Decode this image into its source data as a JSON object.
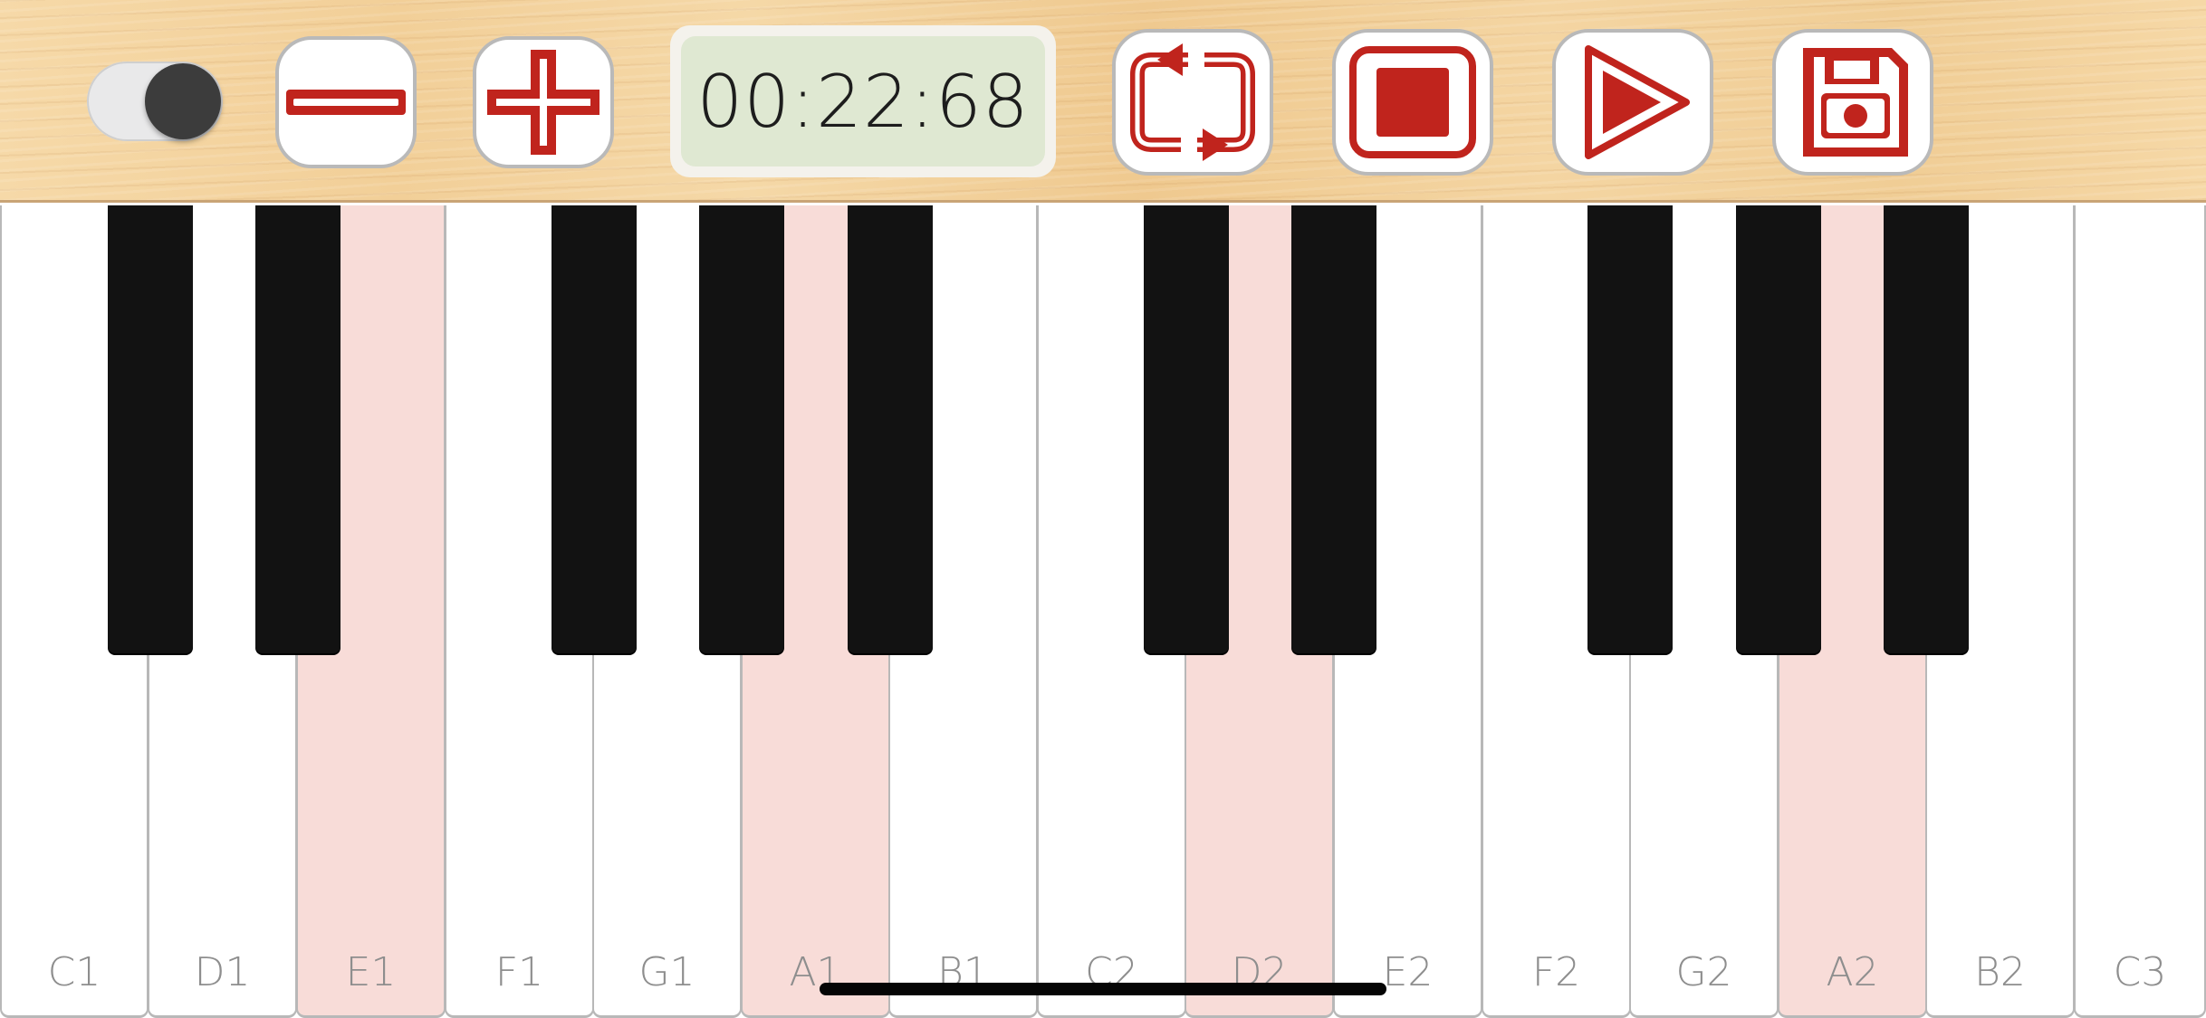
{
  "toolbar": {
    "timer": "00:22:68",
    "toggle": {
      "state": "on"
    },
    "icons": [
      "minus-icon",
      "plus-icon",
      "loop-icon",
      "stop-icon",
      "play-icon",
      "save-icon"
    ],
    "accent_color": "#c0241d"
  },
  "keyboard": {
    "white_keys": [
      {
        "label": "C1",
        "highlighted": false
      },
      {
        "label": "D1",
        "highlighted": false
      },
      {
        "label": "E1",
        "highlighted": true
      },
      {
        "label": "F1",
        "highlighted": false
      },
      {
        "label": "G1",
        "highlighted": false
      },
      {
        "label": "A1",
        "highlighted": true
      },
      {
        "label": "B1",
        "highlighted": false
      },
      {
        "label": "C2",
        "highlighted": false
      },
      {
        "label": "D2",
        "highlighted": true
      },
      {
        "label": "E2",
        "highlighted": false
      },
      {
        "label": "F2",
        "highlighted": false
      },
      {
        "label": "G2",
        "highlighted": false
      },
      {
        "label": "A2",
        "highlighted": true
      },
      {
        "label": "B2",
        "highlighted": false
      },
      {
        "label": "C3",
        "highlighted": false
      }
    ],
    "highlight_color": "#f8dcd8"
  }
}
